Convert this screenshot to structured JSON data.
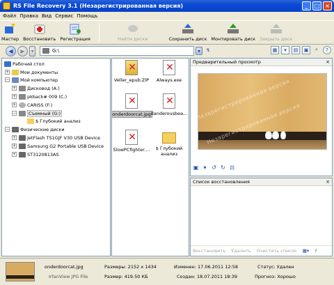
{
  "window": {
    "title": "RS File Recovery 3.1 (Незарегистрированная версия)"
  },
  "menu": [
    "Файл",
    "Правка",
    "Вид",
    "Сервис",
    "Помощь"
  ],
  "toolbar": {
    "master": "Мастер",
    "restore": "Восстановить",
    "register": "Регистрация",
    "find_disks": "Найти диски",
    "save_disk": "Сохранить диск",
    "mount_disk": "Монтировать диск",
    "close_disk": "Закрыть диск"
  },
  "address": {
    "value": "G:\\"
  },
  "tree": [
    {
      "label": "Рабочий стол",
      "level": 0,
      "icon": "desktop-icon"
    },
    {
      "label": "Мои документы",
      "level": 1,
      "icon": "documents-icon"
    },
    {
      "label": "Мой компьютер",
      "level": 1,
      "icon": "computer-icon"
    },
    {
      "label": "Дисковод (A:)",
      "level": 2,
      "icon": "floppy-icon"
    },
    {
      "label": "pkback# 009 (C:)",
      "level": 2,
      "icon": "drive-icon"
    },
    {
      "label": "CARISS (F:)",
      "level": 2,
      "icon": "cd-icon"
    },
    {
      "label": "Съемный (G:)",
      "level": 2,
      "icon": "removable-drive-icon"
    },
    {
      "label": "$ Глубокий анализ",
      "level": 3,
      "icon": "folder-icon"
    },
    {
      "label": "Физические диски",
      "level": 1,
      "icon": "disk-icon"
    },
    {
      "label": "JetFlash TS1GJF V30 USB Device",
      "level": 2,
      "icon": "usb-icon"
    },
    {
      "label": "Samsung G2 Portable USB Device",
      "level": 2,
      "icon": "usb-icon"
    },
    {
      "label": "ST3120813AS",
      "level": 2,
      "icon": "hdd-icon"
    }
  ],
  "files": [
    {
      "name": "Veller_epub.ZIP",
      "icon": "zip-icon"
    },
    {
      "name": "Always.exe",
      "icon": "exe-icon"
    },
    {
      "name": "onderdoorcat.jpg",
      "icon": "image-icon"
    },
    {
      "name": "danderousbea...",
      "icon": "image-icon"
    },
    {
      "name": "SlowPCfighter....",
      "icon": "exe-icon"
    },
    {
      "name": "$ Глубокий анализ",
      "icon": "folder-icon"
    }
  ],
  "preview": {
    "title": "Предварительный просмотр",
    "watermark": "Незарегистрированная версия"
  },
  "recovery": {
    "title": "Список восстановления",
    "restore": "Восстановить",
    "delete": "Удалить",
    "clear": "Очистить список"
  },
  "status": {
    "filename": "onderdoorcat.jpg",
    "filetype": "IrfanView JPG File",
    "size_label": "Размеры: 2152 x 1434",
    "bytes_label": "Размер: 419.50 КБ",
    "modified_label": "Изменен: 17.06.2011 12:58",
    "created_label": "Создан: 18.07.2011 18:39",
    "status_label": "Статус: Удален",
    "forecast_label": "Прогноз: Хорошо"
  }
}
